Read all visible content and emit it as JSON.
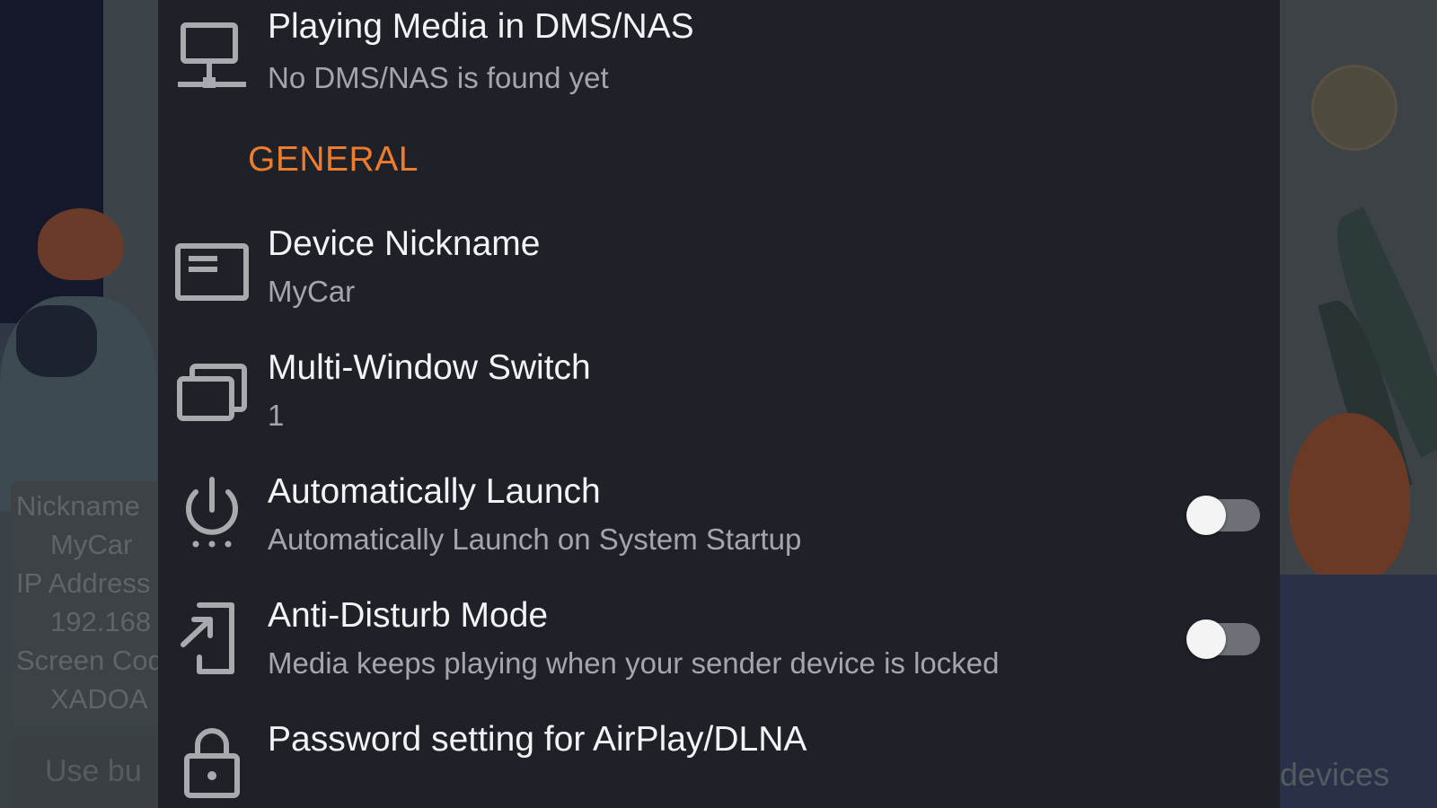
{
  "background_app": {
    "info_card": {
      "nickname_label": "Nickname",
      "nickname_value": "MyCar",
      "ip_label": "IP Address",
      "ip_value": "192.168",
      "screen_code_label": "Screen Code",
      "screen_code_value": "XADOA"
    },
    "bottom_button": "Use bu",
    "devices_label": "devices"
  },
  "settings": {
    "dms_item": {
      "title": "Playing Media in DMS/NAS",
      "subtitle": "No DMS/NAS is found yet",
      "icon": "network-computer-icon"
    },
    "general_header": "GENERAL",
    "items": [
      {
        "title": "Device Nickname",
        "subtitle": "MyCar",
        "icon": "id-card-icon"
      },
      {
        "title": "Multi-Window Switch",
        "subtitle": "1",
        "icon": "multi-window-icon"
      },
      {
        "title": "Automatically Launch",
        "subtitle": "Automatically Launch on System Startup",
        "icon": "power-icon",
        "toggle_on": false
      },
      {
        "title": "Anti-Disturb Mode",
        "subtitle": "Media keeps playing when your sender device is locked",
        "icon": "exit-arrow-icon",
        "toggle_on": false
      },
      {
        "title": "Password setting for AirPlay/DLNA",
        "subtitle": "",
        "icon": "lock-icon"
      }
    ]
  },
  "colors": {
    "sheet_background": "#1f2129",
    "section_header_accent": "#ee7c2c",
    "title_text": "#f2f3f4",
    "subtitle_text": "#a3a7ab",
    "icon_color": "#a7abae",
    "toggle_track_off": "#6d7177",
    "toggle_thumb": "#f4f4f4"
  }
}
